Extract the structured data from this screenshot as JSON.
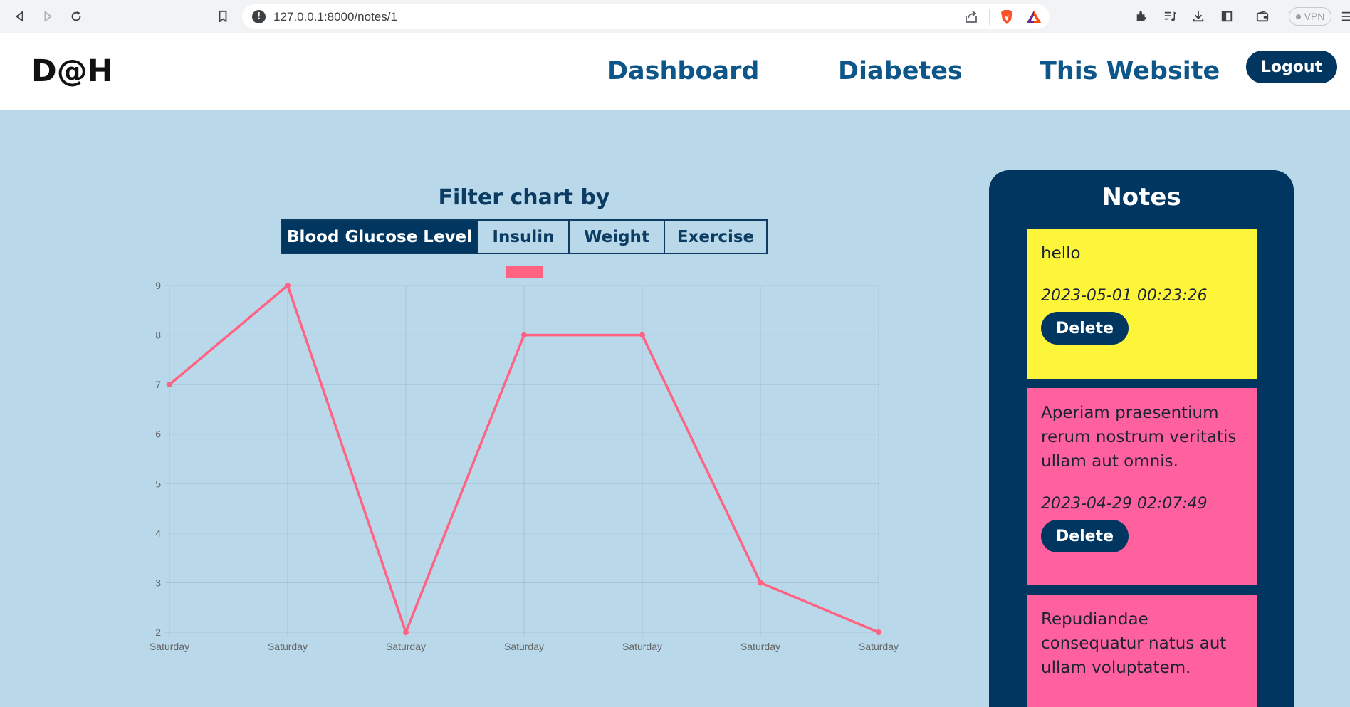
{
  "browser": {
    "url": "127.0.0.1:8000/notes/1",
    "vpn_label": "VPN"
  },
  "header": {
    "logo": "D@H",
    "nav": [
      {
        "label": "Dashboard"
      },
      {
        "label": "Diabetes"
      },
      {
        "label": "This Website"
      }
    ],
    "logout_label": "Logout"
  },
  "filter": {
    "title": "Filter chart by",
    "options": [
      {
        "label": "Blood Glucose Level",
        "active": true
      },
      {
        "label": "Insulin",
        "active": false
      },
      {
        "label": "Weight",
        "active": false
      },
      {
        "label": "Exercise",
        "active": false
      }
    ]
  },
  "chart_data": {
    "type": "line",
    "title": "",
    "xlabel": "",
    "ylabel": "",
    "categories": [
      "Saturday",
      "Saturday",
      "Saturday",
      "Saturday",
      "Saturday",
      "Saturday",
      "Saturday"
    ],
    "series": [
      {
        "values": [
          7,
          9,
          2,
          8,
          8,
          3,
          2
        ],
        "color": "#ff6384"
      }
    ],
    "ylim": [
      2,
      9
    ],
    "yticks": [
      2,
      3,
      4,
      5,
      6,
      7,
      8,
      9
    ],
    "grid": true,
    "legend": "top"
  },
  "notes": {
    "title": "Notes",
    "items": [
      {
        "text": "hello",
        "date": "2023-05-01 00:23:26",
        "delete_label": "Delete",
        "color": "#fdf53a"
      },
      {
        "text": "Aperiam praesentium rerum nostrum veritatis ullam aut omnis.",
        "date": "2023-04-29 02:07:49",
        "delete_label": "Delete",
        "color": "#ff619e"
      },
      {
        "text": "Repudiandae consequatur natus aut ullam voluptatem.",
        "date": "",
        "delete_label": "",
        "color": "#ff619e"
      }
    ]
  },
  "colors": {
    "page_bg": "#b9d9ea",
    "primary": "#003660",
    "nav_text": "#0d5689",
    "line": "#ff6384"
  }
}
